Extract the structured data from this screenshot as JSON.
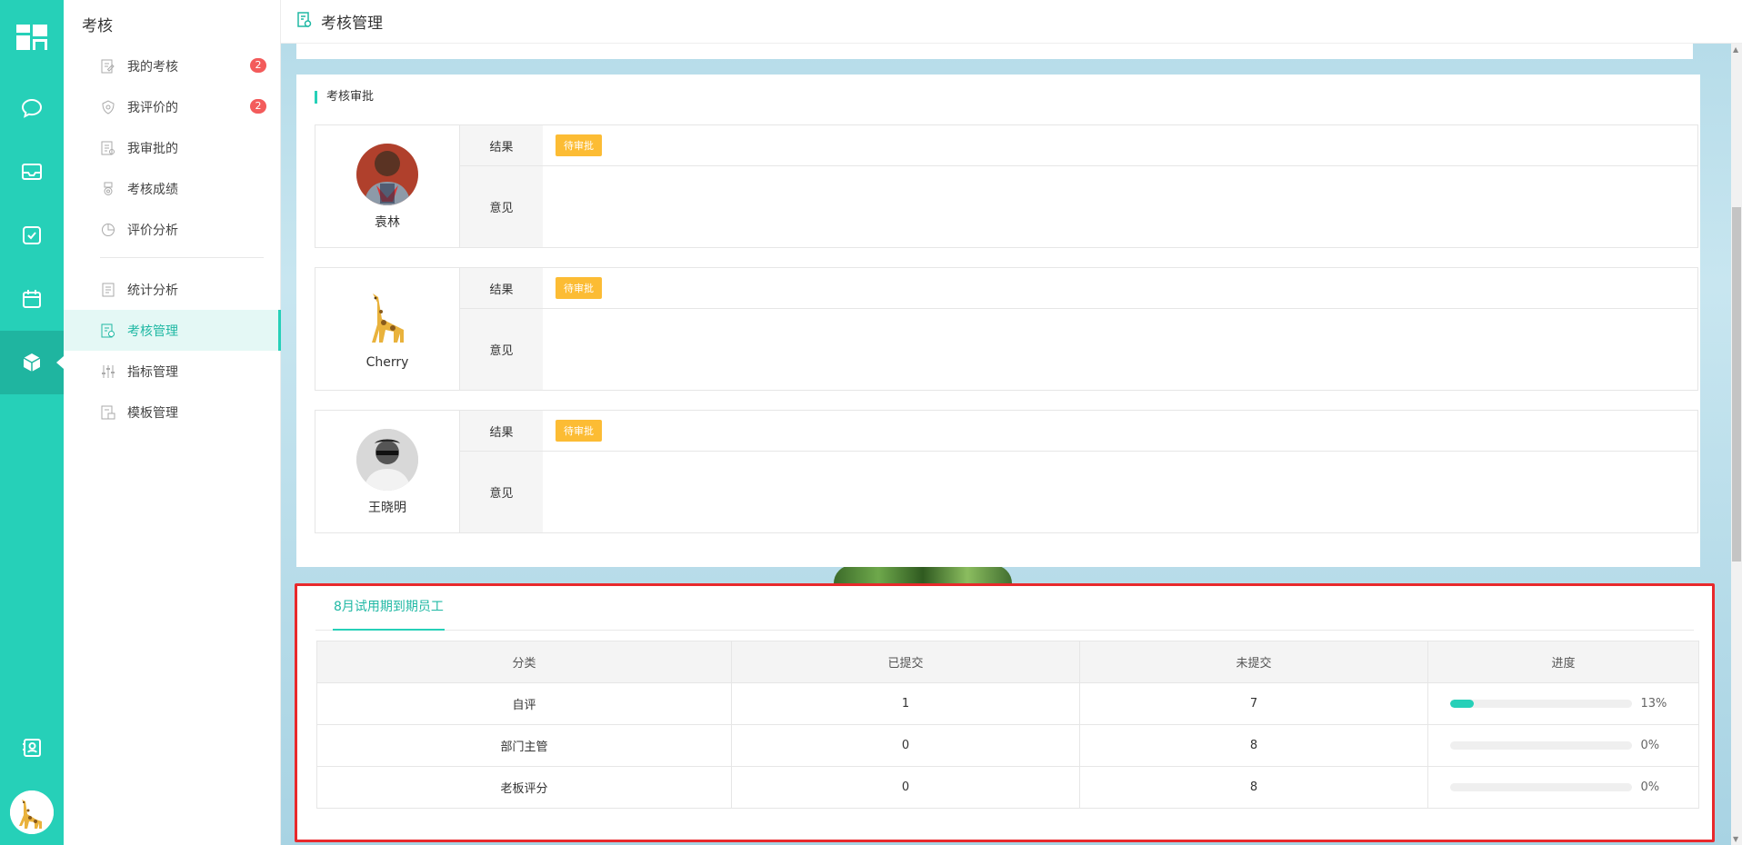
{
  "rail": {
    "items": [
      "grid-icon",
      "chat-icon",
      "inbox-icon",
      "check-icon",
      "calendar-icon",
      "cube-icon"
    ],
    "bottom": [
      "contacts-icon"
    ]
  },
  "sidebar": {
    "title": "考核",
    "items": [
      {
        "label": "我的考核",
        "badge": "2"
      },
      {
        "label": "我评价的",
        "badge": "2"
      },
      {
        "label": "我审批的"
      },
      {
        "label": "考核成绩"
      },
      {
        "label": "评价分析"
      },
      {
        "label": "统计分析"
      },
      {
        "label": "考核管理"
      },
      {
        "label": "指标管理"
      },
      {
        "label": "模板管理"
      }
    ]
  },
  "header": {
    "title": "考核管理"
  },
  "approval": {
    "section_title": "考核审批",
    "result_label": "结果",
    "opinion_label": "意见",
    "people": [
      {
        "name": "袁林",
        "status": "待审批"
      },
      {
        "name": "Cherry",
        "status": "待审批"
      },
      {
        "name": "王晓明",
        "status": "待审批"
      }
    ]
  },
  "probation": {
    "tab": "8月试用期到期员工",
    "columns": [
      "分类",
      "已提交",
      "未提交",
      "进度"
    ],
    "rows": [
      {
        "category": "自评",
        "submitted": "1",
        "unsubmitted": "7",
        "progress": 13,
        "progress_text": "13%"
      },
      {
        "category": "部门主管",
        "submitted": "0",
        "unsubmitted": "8",
        "progress": 0,
        "progress_text": "0%"
      },
      {
        "category": "老板评分",
        "submitted": "0",
        "unsubmitted": "8",
        "progress": 0,
        "progress_text": "0%"
      }
    ]
  },
  "colors": {
    "accent": "#26d0b8",
    "pending": "#fcbc34",
    "badge": "#f35b5b",
    "highlight": "#e8292c"
  }
}
